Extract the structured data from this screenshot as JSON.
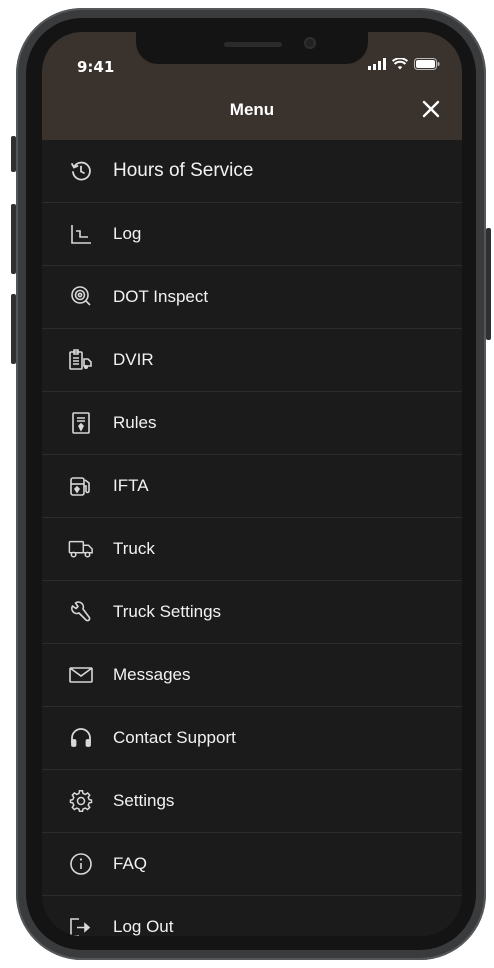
{
  "status_bar": {
    "time": "9:41"
  },
  "header": {
    "title": "Menu"
  },
  "menu": {
    "items": [
      {
        "label": "Hours of Service",
        "icon": "clock-history-icon"
      },
      {
        "label": "Log",
        "icon": "log-chart-icon"
      },
      {
        "label": "DOT Inspect",
        "icon": "inspect-magnifier-icon"
      },
      {
        "label": "DVIR",
        "icon": "dvir-report-icon"
      },
      {
        "label": "Rules",
        "icon": "rules-document-icon"
      },
      {
        "label": "IFTA",
        "icon": "fuel-pump-icon"
      },
      {
        "label": "Truck",
        "icon": "truck-icon"
      },
      {
        "label": "Truck Settings",
        "icon": "wrench-icon"
      },
      {
        "label": "Messages",
        "icon": "envelope-icon"
      },
      {
        "label": "Contact Support",
        "icon": "headphones-icon"
      },
      {
        "label": "Settings",
        "icon": "gear-icon"
      },
      {
        "label": "FAQ",
        "icon": "info-icon"
      },
      {
        "label": "Log Out",
        "icon": "logout-icon"
      }
    ]
  },
  "colors": {
    "header_bg": "#3a322d",
    "screen_bg": "#1b1b1b",
    "text": "#f2f2f2"
  }
}
